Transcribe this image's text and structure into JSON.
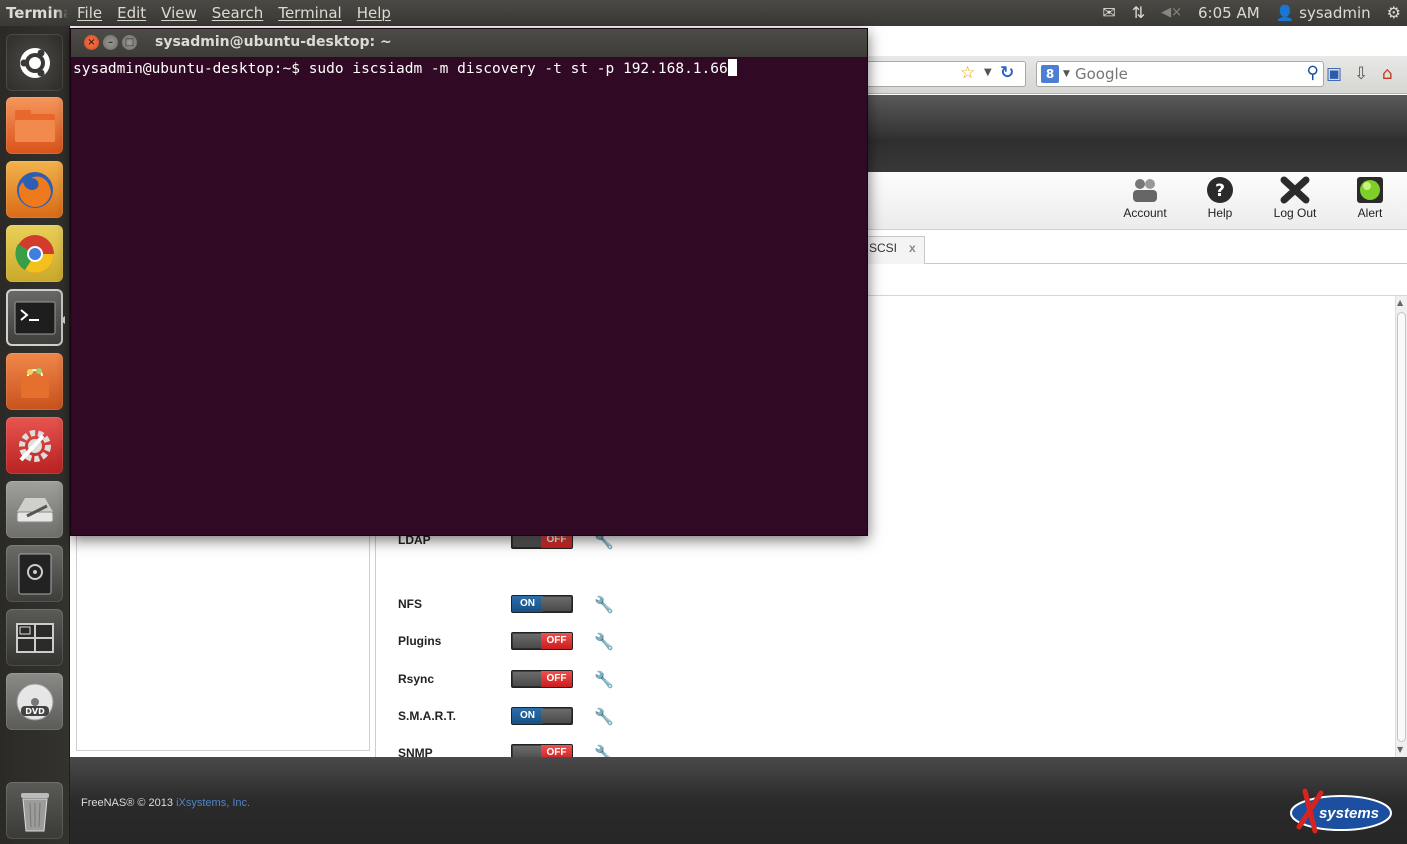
{
  "top_panel": {
    "app_title": "Terminal",
    "menus": [
      "File",
      "Edit",
      "View",
      "Search",
      "Terminal",
      "Help"
    ],
    "clock": "6:05 AM",
    "user": "sysadmin"
  },
  "launcher": {
    "items": [
      "ubuntu-dash",
      "files",
      "firefox",
      "chromium",
      "terminal",
      "software-center",
      "system-settings",
      "disk-utility",
      "backup",
      "workspace-switcher",
      "dvd",
      "trash"
    ]
  },
  "terminal": {
    "title": "sysadmin@ubuntu-desktop: ~",
    "prompt": "sysadmin@ubuntu-desktop:~$ ",
    "command": "sudo iscsiadm -m discovery -t st -p 192.168.1.66"
  },
  "browser": {
    "search_placeholder": "Google",
    "toolbar": [
      {
        "label": "Account"
      },
      {
        "label": "Help"
      },
      {
        "label": "Log Out"
      },
      {
        "label": "Alert"
      }
    ],
    "tab_label": "SCSI",
    "tab_close": "x",
    "services": [
      {
        "name": "LDAP",
        "state": "OFF"
      },
      {
        "name": "NFS",
        "state": "ON"
      },
      {
        "name": "Plugins",
        "state": "OFF"
      },
      {
        "name": "Rsync",
        "state": "OFF"
      },
      {
        "name": "S.M.A.R.T.",
        "state": "ON"
      },
      {
        "name": "SNMP",
        "state": "OFF"
      }
    ],
    "footer_text": "FreeNAS® © 2013 ",
    "footer_link": "iXsystems, Inc.",
    "logo_text": "systems"
  },
  "colors": {
    "terminal_bg": "#300a24",
    "toggle_off": "#d42a2a",
    "toggle_on": "#1f5c94",
    "footer_link": "#4f86c6"
  }
}
